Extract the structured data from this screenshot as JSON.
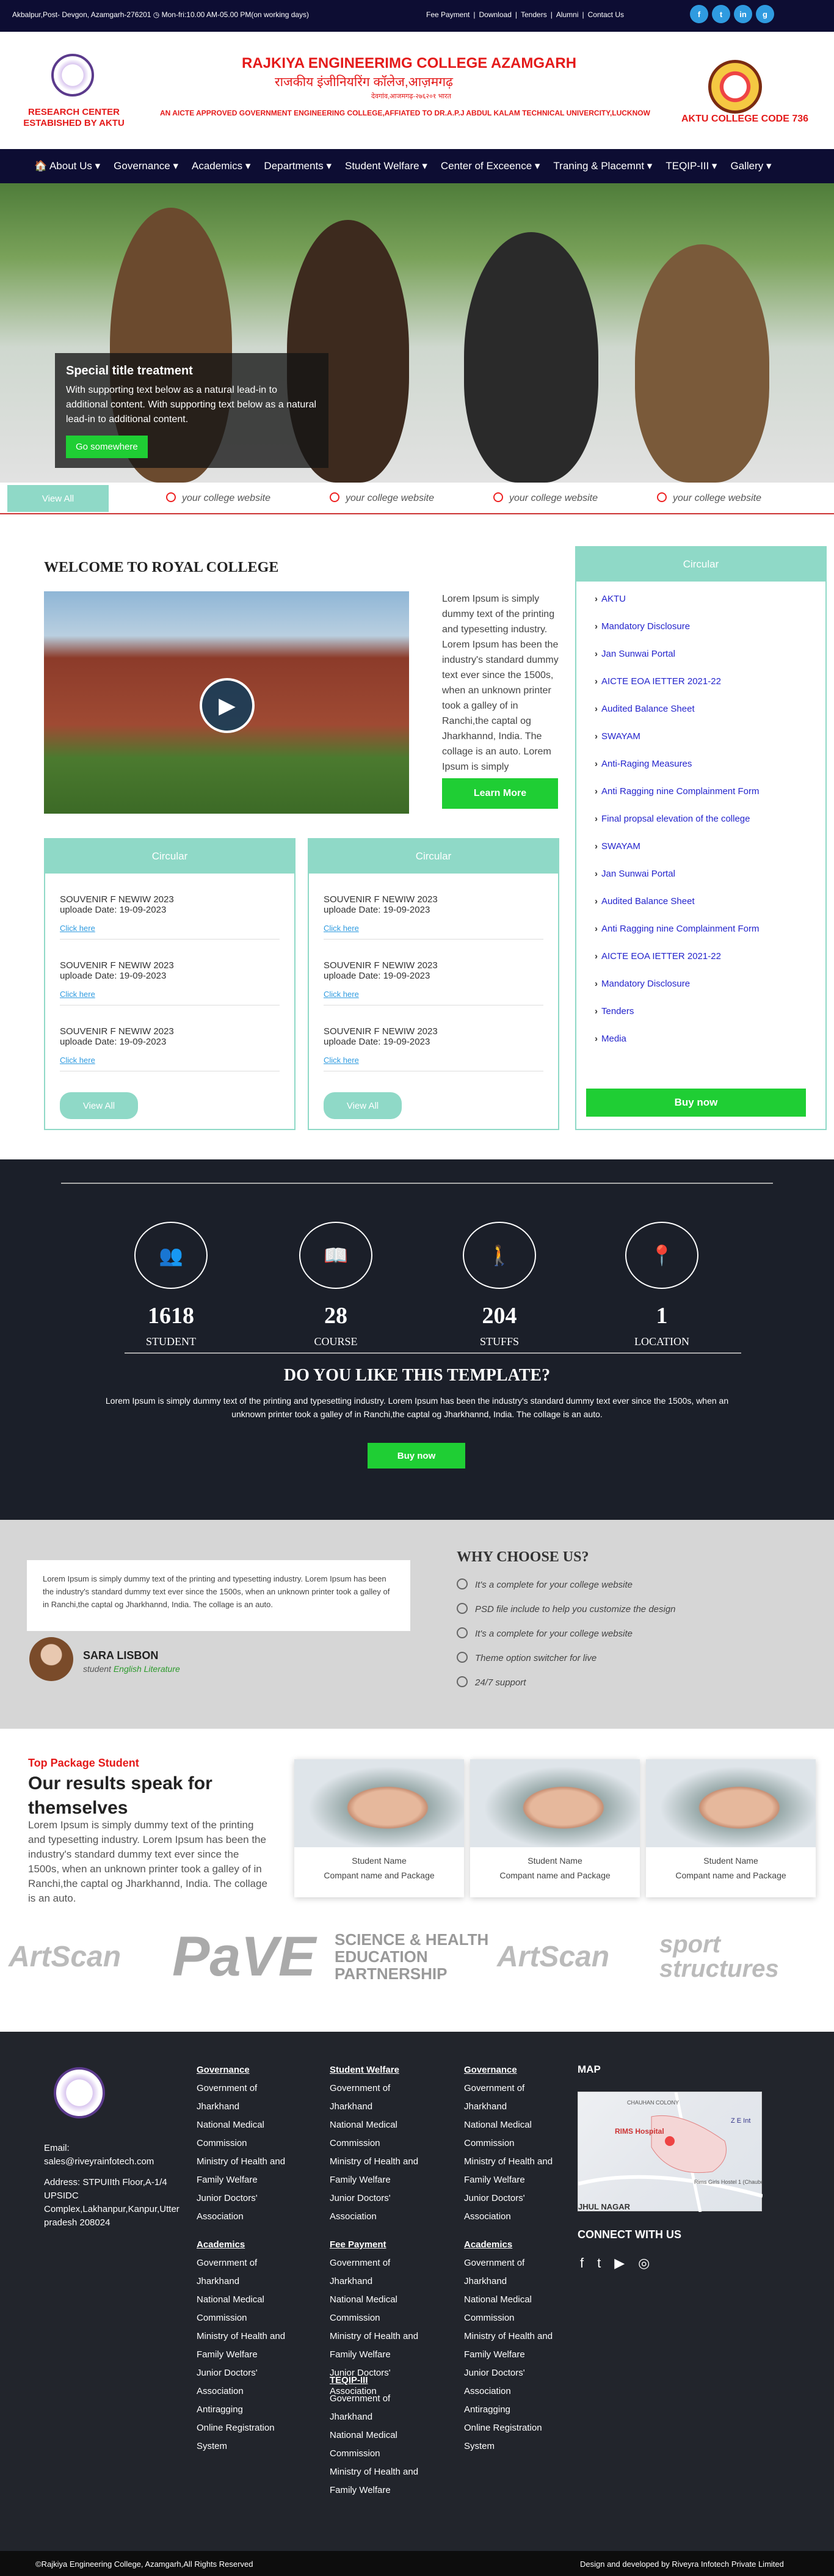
{
  "topbar": {
    "address": "Akbalpur,Post- Devgon, Azamgarh-276201 ◷ Mon-fri:10.00 AM-05.00 PM(on working days)",
    "links": [
      "Fee Payment",
      "Download",
      "Tenders",
      "Alumni",
      "Contact Us"
    ],
    "social": [
      "f",
      "t",
      "in",
      "g"
    ]
  },
  "header": {
    "research": "RESEARCH CENTER ESTABISHED BY AKTU",
    "title_en": "RAJKIYA ENGINEERIMG COLLEGE AZAMGARH",
    "title_hi": "राजकीय इंजीनियरिंग कॉलेज,आज़मगढ़",
    "title_hi_small": "देवगांव,आजमगढ़-२७६२०१ भारत",
    "affiliation": "AN AICTE APPROVED GOVERNMENT ENGINEERING COLLEGE,AFFIATED TO DR.A.P.J ABDUL KALAM TECHNICAL UNIVERCITY,LUCKNOW",
    "code": "AKTU COLLEGE CODE 736"
  },
  "nav": [
    "About Us ▾",
    "Governance ▾",
    "Academics ▾",
    "Departments ▾",
    "Student Welfare ▾",
    "Center of Exceence ▾",
    "Traning & Placemnt ▾",
    "TEQIP-III ▾",
    "Gallery ▾"
  ],
  "hero": {
    "title": "Special title treatment",
    "text": "With supporting text below as a natural lead-in to additional content. With supporting text below as a natural lead-in to additional content.",
    "button": "Go somewhere"
  },
  "ticker": {
    "viewall": "View All",
    "item": "your college website"
  },
  "welcome": {
    "title": "WELCOME TO ROYAL COLLEGE",
    "text": "Lorem Ipsum is simply dummy text of the printing and typesetting industry. Lorem Ipsum has been the industry's standard dummy text ever since the 1500s, when an unknown printer took a galley of in Ranchi,the captal og Jharkhannd, India. The collage is an auto. Lorem Ipsum is simply",
    "button": "Learn More"
  },
  "circular": {
    "title": "Circular",
    "item_title": "SOUVENIR F NEWIW 2023",
    "item_date": "uploade Date: 19-09-2023",
    "click": "Click here",
    "viewall": "View All"
  },
  "side": {
    "title": "Circular",
    "items": [
      "AKTU",
      "Mandatory Disclosure",
      "Jan Sunwai Portal",
      "AICTE EOA IETTER 2021-22",
      "Audited Balance Sheet",
      "SWAYAM",
      "Anti-Raging Measures",
      "Anti Ragging nine Complainment Form",
      "Final propsal elevation of the college",
      "SWAYAM",
      "Jan Sunwai Portal",
      "Audited Balance Sheet",
      "Anti Ragging nine Complainment Form",
      "AICTE EOA IETTER 2021-22",
      "Mandatory Disclosure",
      "Tenders",
      "Media"
    ],
    "buy": "Buy now"
  },
  "stats": [
    {
      "n": "1618",
      "l": "STUDENT",
      "icon": "users-icon",
      "g": "👥"
    },
    {
      "n": "28",
      "l": "COURSE",
      "icon": "book-icon",
      "g": "📖"
    },
    {
      "n": "204",
      "l": "STUFFS",
      "icon": "person-icon",
      "g": "🚶"
    },
    {
      "n": "1",
      "l": "LOCATION",
      "icon": "location-icon",
      "g": "📍"
    }
  ],
  "promo": {
    "q": "DO YOU LIKE THIS TEMPLATE?",
    "text": "Lorem Ipsum is simply dummy text of the printing and typesetting industry. Lorem Ipsum has been the industry's standard dummy text ever since the 1500s, when an unknown printer took a galley of in Ranchi,the captal og Jharkhannd, India. The collage is an auto.",
    "button": "Buy now"
  },
  "testimonial": {
    "text": "Lorem Ipsum is simply dummy text of the printing and typesetting industry. Lorem Ipsum has been the industry's standard dummy text ever since the 1500s, when an unknown printer took a galley of in Ranchi,the captal og Jharkhannd, India. The collage is an auto.",
    "name": "SARA LISBON",
    "role": "student",
    "subject": "English Literature"
  },
  "why": {
    "title": "WHY CHOOSE US?",
    "items": [
      "It's a complete for your college website",
      "PSD file include to help you customize the design",
      "It's a complete for your college website",
      "Theme option switcher for live",
      "24/7 support"
    ]
  },
  "results": {
    "tag": "Top Package Student",
    "title": "Our results speak for themselves",
    "text": "Lorem Ipsum is simply dummy text of the printing and typesetting industry. Lorem Ipsum has been the industry's standard dummy text ever since the 1500s, when an unknown printer took a galley of in Ranchi,the captal og Jharkhannd, India. The collage is an auto.",
    "name": "Student Name",
    "company": "Compant name and Package"
  },
  "brands": [
    "ArtScan",
    "PaVE",
    "SCIENCE & HEALTH EDUCATION PARTNERSHIP",
    "ArtScan",
    "sport structures"
  ],
  "footer": {
    "email": "Email: sales@riveyrainfotech.com",
    "address": "Address: STPUIIth Floor,A-1/4 UPSIDC Complex,Lakhanpur,Kanpur,Utter pradesh 208024",
    "cols": [
      {
        "h": "Governance",
        "items": [
          "Government of Jharkhand",
          "National Medical Commission",
          "Ministry of Health and Family Welfare",
          "Junior Doctors' Association"
        ]
      },
      {
        "h": "Student Welfare",
        "items": [
          "Government of Jharkhand",
          "National Medical Commission",
          "Ministry of Health and Family Welfare",
          "Junior Doctors' Association"
        ]
      },
      {
        "h": "Governance",
        "items": [
          "Government of Jharkhand",
          "National Medical Commission",
          "Ministry of Health and Family Welfare",
          "Junior Doctors' Association"
        ]
      },
      {
        "h": "Academics",
        "items": [
          "Government of Jharkhand",
          "National Medical Commission",
          "Ministry of Health and Family Welfare",
          "Junior Doctors' Association",
          "Antiragging",
          "Online Registration System"
        ]
      },
      {
        "h": "Fee Payment",
        "items": [
          "Government of Jharkhand",
          "National Medical Commission",
          "Ministry of Health and Family Welfare",
          "Junior Doctors' Association"
        ]
      },
      {
        "h": "Academics",
        "items": [
          "Government of Jharkhand",
          "National Medical Commission",
          "Ministry of Health and Family Welfare",
          "Junior Doctors' Association",
          "Antiragging",
          "Online Registration System"
        ]
      },
      {
        "h": "TEQIP-III",
        "items": [
          "Government of Jharkhand",
          "National Medical Commission",
          "Ministry of Health and Family Welfare"
        ]
      }
    ],
    "map": "MAP",
    "map_labels": [
      "CHAUHAN COLONY",
      "RIMS Hospital",
      "Z E Int",
      "Rims Girls Hostel 1 (Chaubey Pa",
      "JHUL NAGAR"
    ],
    "connect": "CONNECT WITH US",
    "social": [
      "f",
      "t",
      "▶",
      "◎"
    ]
  },
  "bottom": {
    "left": "©Rajkiya Engineering College, Azamgarh,All Rights Reserved",
    "right": "Design and developed by Riveyra Infotech Private Limited"
  },
  "colors": {
    "navy": "#0d0d33",
    "green": "#1fce34",
    "teal": "#8fd9c7",
    "red": "#e41a1a"
  }
}
